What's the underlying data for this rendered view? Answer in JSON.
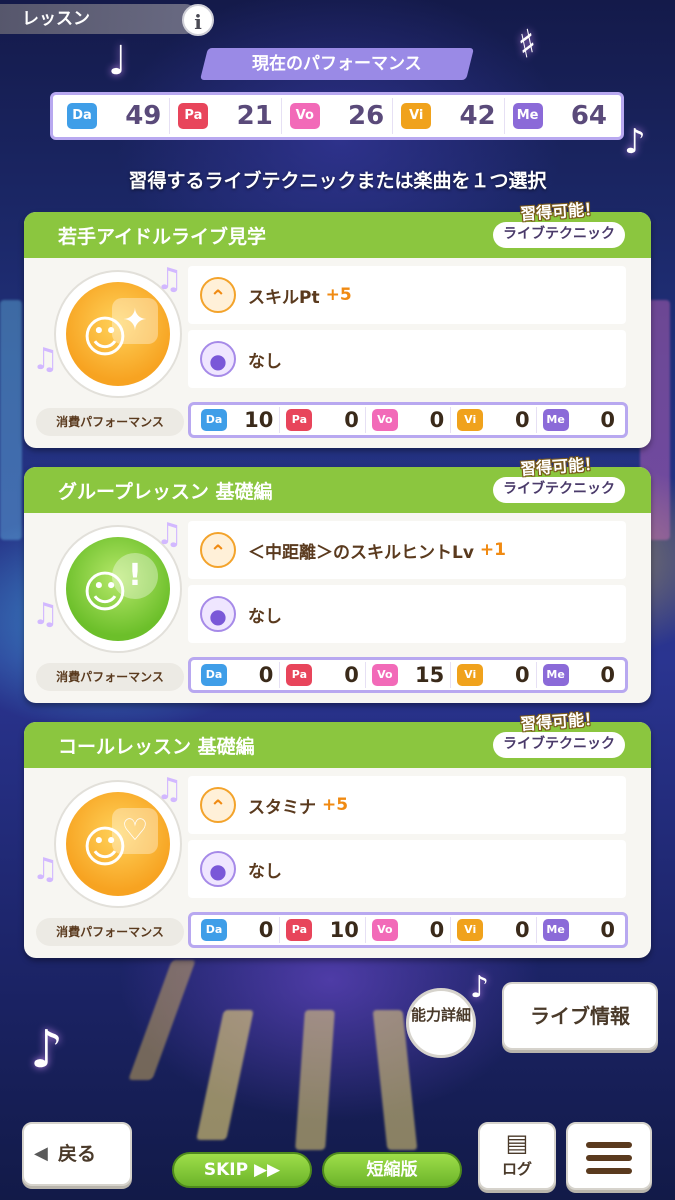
{
  "header": {
    "title": "レッスン",
    "info_label": "i"
  },
  "performance": {
    "title": "現在のパフォーマンス",
    "stats": [
      {
        "badge": "Da",
        "value": "49"
      },
      {
        "badge": "Pa",
        "value": "21"
      },
      {
        "badge": "Vo",
        "value": "26"
      },
      {
        "badge": "Vi",
        "value": "42"
      },
      {
        "badge": "Me",
        "value": "64"
      }
    ]
  },
  "instruction": "習得するライブテクニックまたは楽曲を１つ選択",
  "cards": [
    {
      "title": "若手アイドルライブ見学",
      "tag": "ライブテクニック",
      "available": "習得可能！",
      "effect": "スキルPt",
      "effect_plus": "+5",
      "song": "なし",
      "cost_label": "消費パフォーマンス",
      "costs": [
        "10",
        "0",
        "0",
        "0",
        "0"
      ],
      "icon": "skill-pt-icon"
    },
    {
      "title": "グループレッスン 基礎編",
      "tag": "ライブテクニック",
      "available": "習得可能！",
      "effect": "＜中距離＞のスキルヒントLv",
      "effect_plus": "+1",
      "song": "なし",
      "cost_label": "消費パフォーマンス",
      "costs": [
        "0",
        "0",
        "15",
        "0",
        "0"
      ],
      "icon": "skill-hint-icon"
    },
    {
      "title": "コールレッスン 基礎編",
      "tag": "ライブテクニック",
      "available": "習得可能！",
      "effect": "スタミナ",
      "effect_plus": "+5",
      "song": "なし",
      "cost_label": "消費パフォーマンス",
      "costs": [
        "0",
        "10",
        "0",
        "0",
        "0"
      ],
      "icon": "stamina-icon"
    }
  ],
  "badges": [
    "Da",
    "Pa",
    "Vo",
    "Vi",
    "Me"
  ],
  "controls": {
    "ability_detail": "能力詳細",
    "live_info": "ライブ情報",
    "back": "戻る",
    "skip": "SKIP ▶▶",
    "short": "短縮版",
    "log": "ログ"
  },
  "colors": {
    "card_header": "#8bc63f",
    "accent_purple": "#9a8ae6",
    "da": "#3f9ee8",
    "pa": "#e8455b",
    "vo": "#f26ab8",
    "vi": "#f0a21c",
    "me": "#8b6ad8"
  }
}
